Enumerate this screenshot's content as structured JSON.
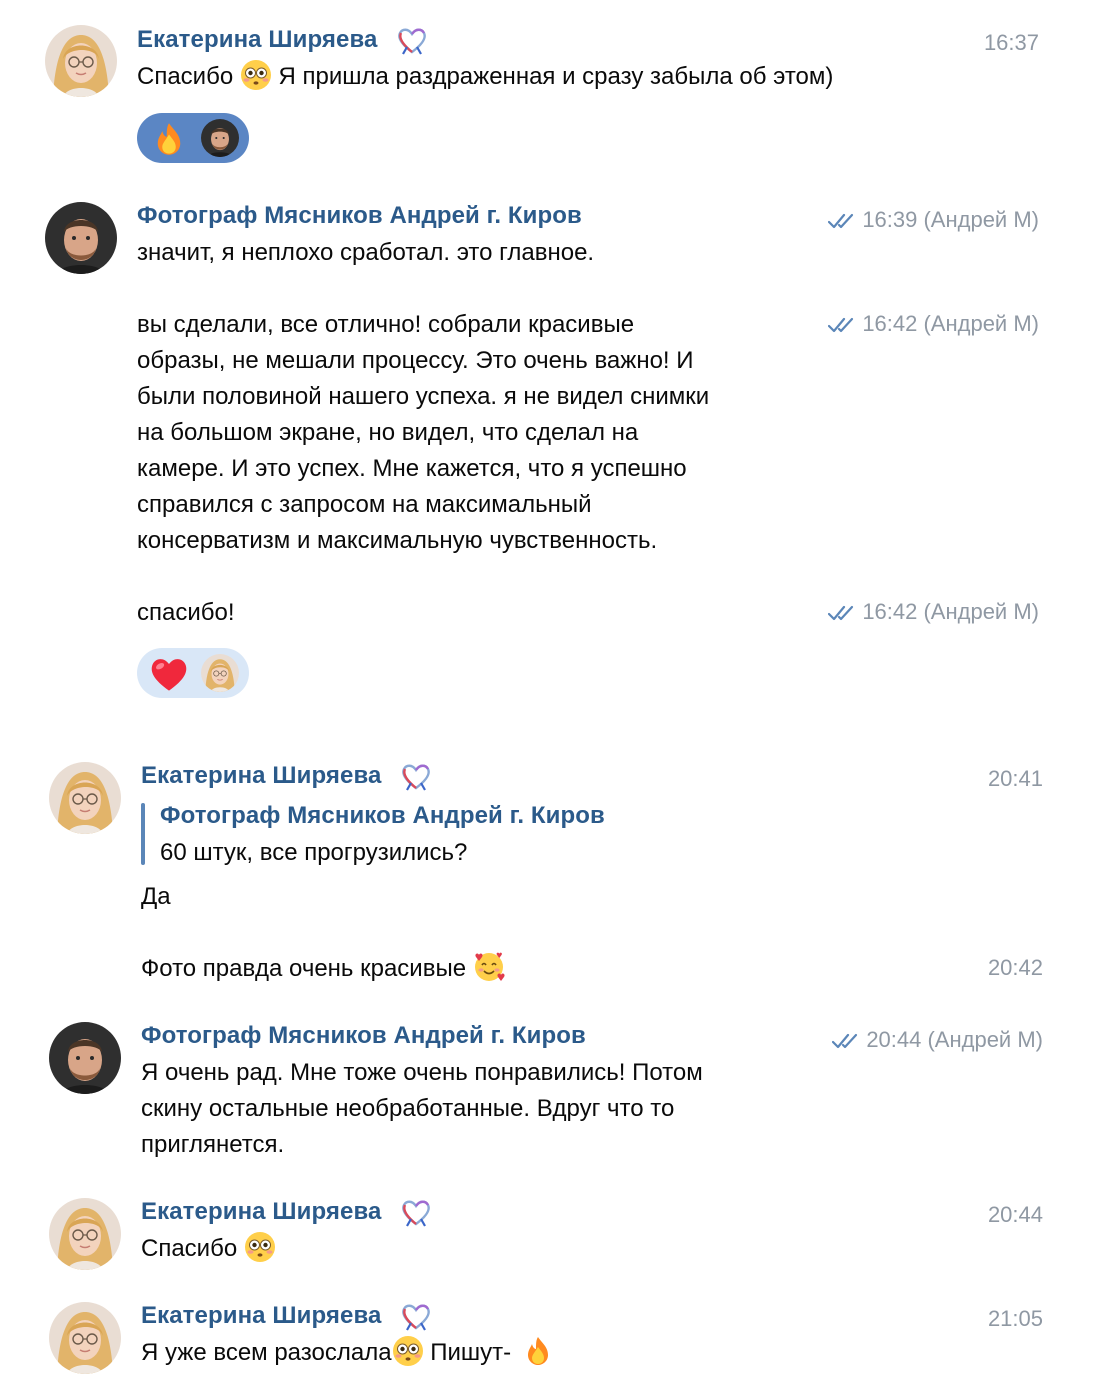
{
  "sender_ekaterina": "Екатерина Ширяева",
  "sender_andrey": "Фотограф Мясников Андрей г. Киров",
  "messages": [
    {
      "time": "16:37",
      "text": "Спасибо",
      "text_after": "Я пришла раздраженная и сразу забыла об этом)"
    },
    {
      "time": "16:39 (Андрей М)",
      "text": "значит, я неплохо сработал. это главное."
    },
    {
      "time": "16:42 (Андрей М)",
      "lines": [
        "вы сделали, все отлично! собрали красивые",
        "образы, не мешали процессу. Это очень важно! И",
        "были половиной нашего успеха. я не видел снимки",
        "на большом экране, но видел, что сделал на",
        "камере. И это успех. Мне кажется, что я успешно",
        "справился с запросом на максимальный",
        "консерватизм и максимальную чувственность."
      ]
    },
    {
      "time": "16:42 (Андрей М)",
      "text": "спасибо!"
    },
    {
      "time": "20:41",
      "reply_author": "Фотограф Мясников Андрей г. Киров",
      "reply_text": "60 штук, все прогрузились?",
      "text": "Да"
    },
    {
      "time": "20:42",
      "text": "Фото правда очень красивые"
    },
    {
      "time": "20:44 (Андрей М)",
      "lines": [
        "Я очень рад. Мне тоже очень понравились! Потом",
        "скину остальные необработанные. Вдруг что то",
        "приглянется."
      ]
    },
    {
      "time": "20:44",
      "text": "Спасибо"
    },
    {
      "time": "21:05",
      "text": "Я уже всем разослала",
      "text_after": "Пишут-"
    }
  ],
  "reactions": [
    {
      "emoji": "fire-emoji",
      "user": "andrey"
    },
    {
      "emoji": "heart-emoji",
      "user": "ekaterina"
    }
  ],
  "colors": {
    "name": "#2b5a8a",
    "time": "#8f98a3",
    "check": "#5b86b8",
    "reaction_bg_1": "#5b86c4",
    "reaction_bg_2": "#d9e7f7"
  }
}
